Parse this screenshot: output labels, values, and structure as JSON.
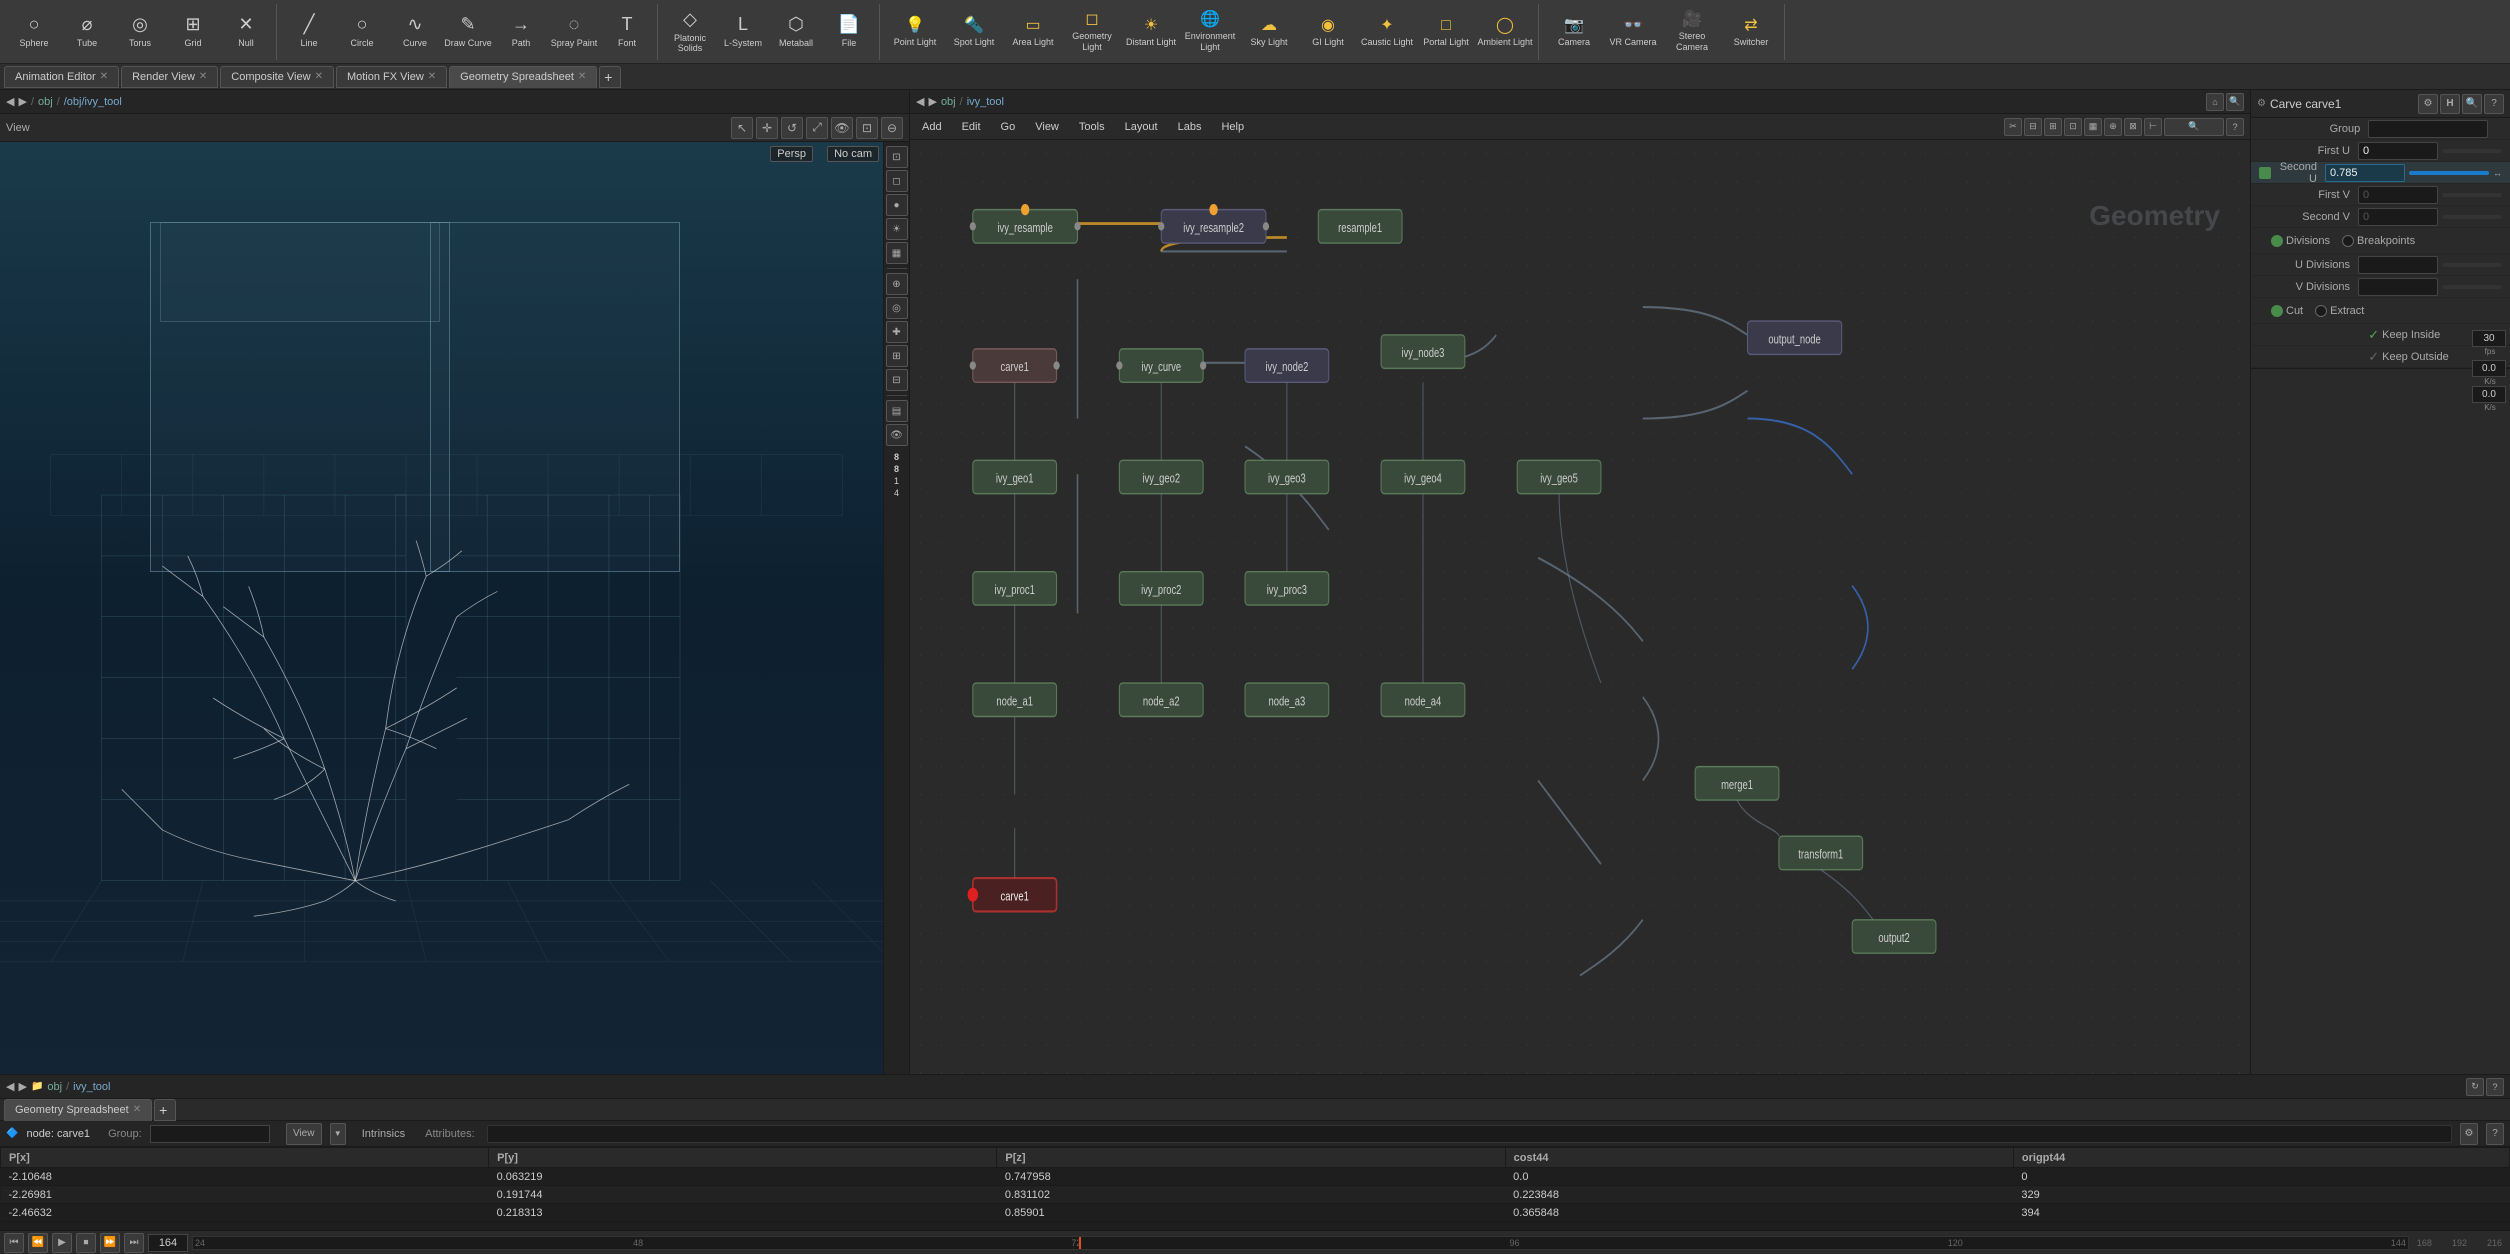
{
  "topbar": {
    "tool_groups": [
      {
        "name": "primitives",
        "tools": [
          {
            "label": "Sphere",
            "icon": "○"
          },
          {
            "label": "Tube",
            "icon": "⌀"
          },
          {
            "label": "Torus",
            "icon": "◎"
          },
          {
            "label": "Grid",
            "icon": "⊞"
          },
          {
            "label": "Null",
            "icon": "✕"
          }
        ]
      },
      {
        "name": "curves",
        "tools": [
          {
            "label": "Line",
            "icon": "╱"
          },
          {
            "label": "Circle",
            "icon": "○"
          },
          {
            "label": "Curve",
            "icon": "∿"
          },
          {
            "label": "Draw Curve",
            "icon": "✎"
          },
          {
            "label": "Path",
            "icon": "→"
          },
          {
            "label": "Spray Paint",
            "icon": "◌"
          },
          {
            "label": "Font",
            "icon": "T"
          }
        ]
      },
      {
        "name": "objects",
        "tools": [
          {
            "label": "Platonic Solids",
            "icon": "◇"
          },
          {
            "label": "L-System",
            "icon": "L"
          },
          {
            "label": "Metaball",
            "icon": "⬡"
          },
          {
            "label": "File",
            "icon": "📄"
          }
        ]
      }
    ],
    "lights": [
      {
        "label": "Point Light",
        "icon": "💡"
      },
      {
        "label": "Spot Light",
        "icon": "🔦"
      },
      {
        "label": "Area Light",
        "icon": "▭"
      },
      {
        "label": "Geometry Light",
        "icon": "◻"
      },
      {
        "label": "Distant Light",
        "icon": "☀"
      },
      {
        "label": "Environment Light",
        "icon": "🌐"
      },
      {
        "label": "Sky Light",
        "icon": "☁"
      },
      {
        "label": "GI Light",
        "icon": "◉"
      },
      {
        "label": "Caustic Light",
        "icon": "✦"
      },
      {
        "label": "Portal Light",
        "icon": "□"
      },
      {
        "label": "Ambient Light",
        "icon": "◯"
      }
    ],
    "cameras": [
      {
        "label": "Camera",
        "icon": "📷"
      },
      {
        "label": "VR Camera",
        "icon": "👓"
      },
      {
        "label": "Stereo Camera",
        "icon": "🎥"
      },
      {
        "label": "Switcher",
        "icon": "⇄"
      }
    ]
  },
  "tabs": [
    {
      "label": "Animation Editor",
      "active": false,
      "closable": true
    },
    {
      "label": "Render View",
      "active": false,
      "closable": true
    },
    {
      "label": "Composite View",
      "active": false,
      "closable": true
    },
    {
      "label": "Motion FX View",
      "active": false,
      "closable": true
    },
    {
      "label": "Geometry Spreadsheet",
      "active": true,
      "closable": true
    }
  ],
  "viewport": {
    "path": "/obj/ivy_tool",
    "label": "View",
    "persp": "Persp",
    "nocam": "No cam"
  },
  "node_editor": {
    "path_obj": "obj",
    "path_node": "ivy_tool",
    "menu_items": [
      "Add",
      "Edit",
      "Go",
      "View",
      "Tools",
      "Layout",
      "Labs",
      "Help"
    ],
    "node_name": "Carve carve1",
    "geometry_label": "Geometry"
  },
  "properties": {
    "title": "Carve  carve1",
    "params": {
      "group": {
        "label": "Group",
        "value": ""
      },
      "first_u": {
        "label": "First U",
        "value": "0"
      },
      "second_u": {
        "label": "Second U",
        "value": "0.785"
      },
      "first_v": {
        "label": "First V",
        "value": "0"
      },
      "second_v": {
        "label": "Second V",
        "value": "0"
      },
      "divisions_radio": {
        "label": "Divisions",
        "checked": true
      },
      "breakpoints_radio": {
        "label": "Breakpoints",
        "checked": false
      },
      "u_divisions": {
        "label": "U Divisions",
        "value": ""
      },
      "v_divisions": {
        "label": "V Divisions",
        "value": ""
      },
      "cut_radio": {
        "label": "Cut",
        "checked": true
      },
      "extract_radio": {
        "label": "Extract",
        "checked": false
      },
      "keep_inside": {
        "label": "Keep Inside",
        "checked": true
      },
      "keep_outside": {
        "label": "Keep Outside",
        "checked": false
      }
    }
  },
  "spreadsheet": {
    "node_label": "node: carve1",
    "group_label": "Group:",
    "view_label": "View",
    "intrinsics_label": "Intrinsics",
    "attributes_label": "Attributes:",
    "columns": [
      "P[x]",
      "P[y]",
      "P[z]",
      "cost44",
      "origpt44"
    ],
    "rows": [
      [
        "-2.10648",
        "0.063219",
        "0.747958",
        "0.0",
        "0"
      ],
      [
        "-2.26981",
        "0.191744",
        "0.831102",
        "0.223848",
        "329"
      ],
      [
        "-2.46632",
        "0.218313",
        "0.85901",
        "0.365848",
        "394"
      ]
    ]
  },
  "timeline": {
    "current_frame": "164",
    "ticks": [
      "24",
      "48",
      "72",
      "96",
      "120",
      "144"
    ],
    "end_ticks": [
      "168",
      "192",
      "216"
    ],
    "fps_label": "30",
    "rate1": "0.0",
    "rate2": "0.0",
    "rate_unit": "K/s"
  }
}
